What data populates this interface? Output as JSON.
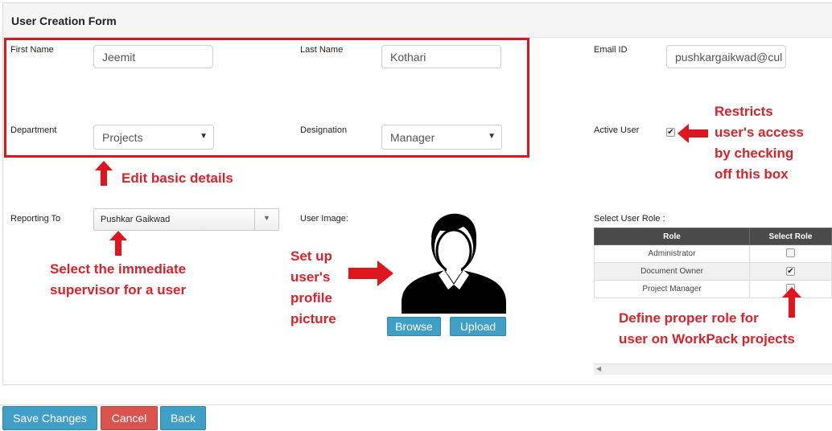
{
  "form": {
    "title": "User Creation Form",
    "first_name": {
      "label": "First Name",
      "value": "Jeemit"
    },
    "last_name": {
      "label": "Last Name",
      "value": "Kothari"
    },
    "email": {
      "label": "Email ID",
      "value": "pushkargaikwad@cul"
    },
    "department": {
      "label": "Department",
      "value": "Projects"
    },
    "designation": {
      "label": "Designation",
      "value": "Manager"
    },
    "active_user": {
      "label": "Active User",
      "checked": true
    },
    "reporting_to": {
      "label": "Reporting To",
      "value": "Pushkar Gaikwad"
    },
    "user_image": {
      "label": "User Image:",
      "browse": "Browse",
      "upload": "Upload"
    },
    "user_role": {
      "label": "Select User Role :",
      "headers": [
        "Role",
        "Select Role"
      ],
      "rows": [
        {
          "role": "Administrator",
          "checked": false
        },
        {
          "role": "Document Owner",
          "checked": true
        },
        {
          "role": "Project Manager",
          "checked": false
        }
      ]
    }
  },
  "annotations": {
    "edit_basic": "Edit basic details",
    "restricts_1": "Restricts",
    "restricts_2": "user's access",
    "restricts_3": "by checking",
    "restricts_4": "off this box",
    "supervisor_1": "Select the immediate",
    "supervisor_2": "supervisor for a user",
    "picture_1": "Set up",
    "picture_2": "user's",
    "picture_3": "profile",
    "picture_4": "picture",
    "role_1": "Define proper role for",
    "role_2": "user on WorkPack projects"
  },
  "footer": {
    "save": "Save Changes",
    "cancel": "Cancel",
    "back": "Back"
  },
  "colors": {
    "annotation": "#d9232a",
    "primary_button": "#3f9fc6",
    "cancel_button": "#d9534f"
  }
}
